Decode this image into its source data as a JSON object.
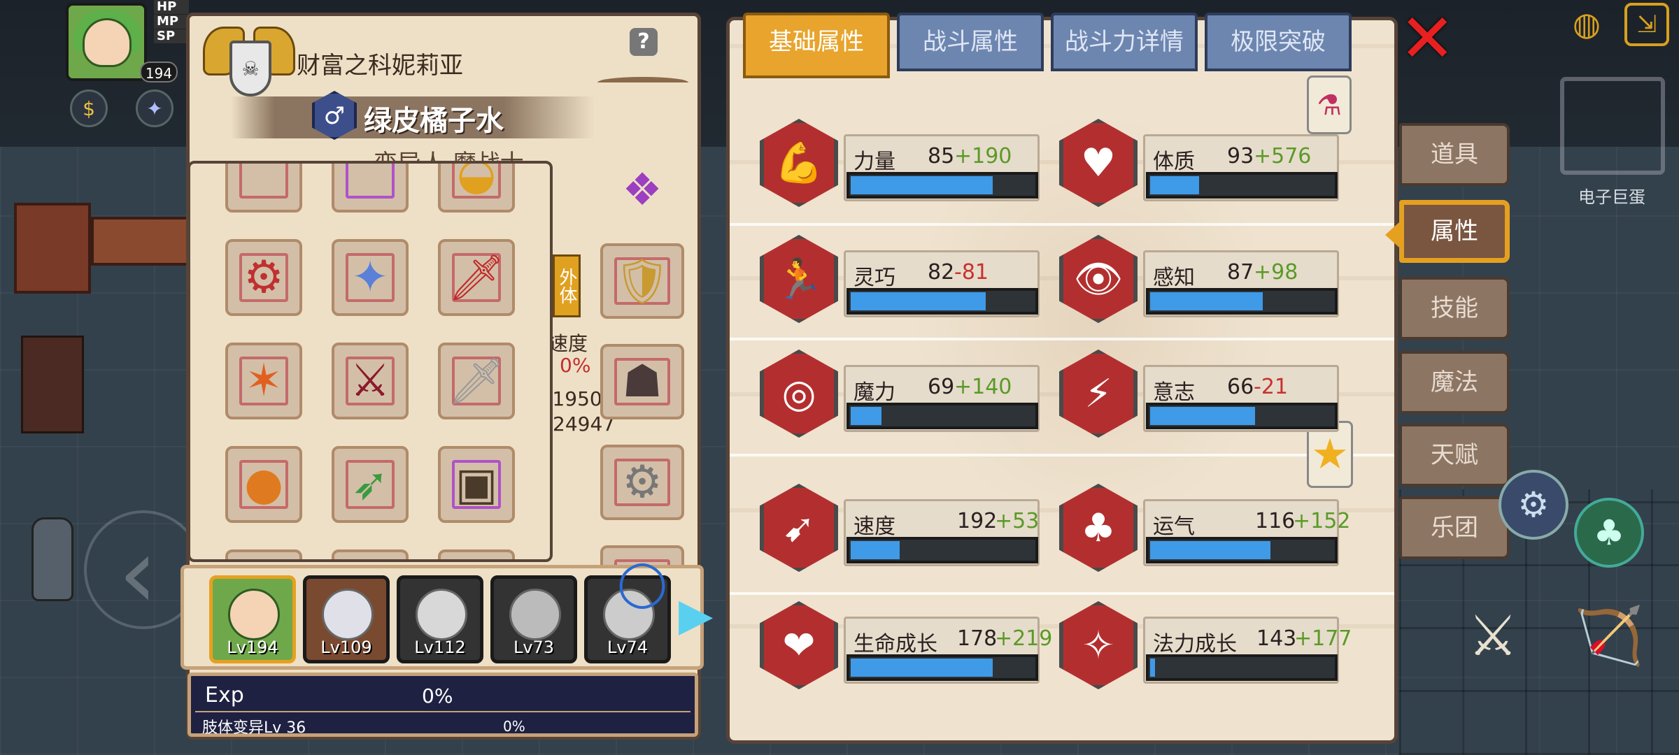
{
  "hud": {
    "level": "194",
    "bars": [
      "HP",
      "MP",
      "SP"
    ]
  },
  "character": {
    "title": "财富之科妮莉亚",
    "name": "绿皮橘子水",
    "class": "变异人 魔战士",
    "side_tag": "外体",
    "partial_text": [
      "速度",
      "0%",
      "/1950",
      "24947"
    ]
  },
  "party": [
    {
      "level": "Lv194",
      "active": true
    },
    {
      "level": "Lv109",
      "active": false
    },
    {
      "level": "Lv112",
      "active": false
    },
    {
      "level": "Lv73",
      "active": false
    },
    {
      "level": "Lv74",
      "active": false
    }
  ],
  "exp": {
    "label": "Exp",
    "value": "0%",
    "mutation_label": "肢体变异Lv 36",
    "mutation_value": "0%"
  },
  "tabs": [
    {
      "label": "基础属性",
      "active": true
    },
    {
      "label": "战斗属性",
      "active": false
    },
    {
      "label": "战斗力详情",
      "active": false
    },
    {
      "label": "极限突破",
      "active": false
    }
  ],
  "stats": [
    {
      "name": "力量",
      "base": "85",
      "bonus": "+190",
      "sign": "pos",
      "fill": 0.78,
      "icon": "muscle-icon",
      "glyph": "💪"
    },
    {
      "name": "体质",
      "base": "93",
      "bonus": "+576",
      "sign": "pos",
      "fill": 0.28,
      "icon": "body-icon",
      "glyph": "♥"
    },
    {
      "name": "灵巧",
      "base": "82",
      "bonus": "-81",
      "sign": "neg",
      "fill": 0.74,
      "icon": "runner-icon",
      "glyph": "🏃"
    },
    {
      "name": "感知",
      "base": "87",
      "bonus": "+98",
      "sign": "pos",
      "fill": 0.62,
      "icon": "eye-icon",
      "glyph": "👁"
    },
    {
      "name": "魔力",
      "base": "69",
      "bonus": "+140",
      "sign": "pos",
      "fill": 0.18,
      "icon": "swirl-icon",
      "glyph": "◎"
    },
    {
      "name": "意志",
      "base": "66",
      "bonus": "-21",
      "sign": "neg",
      "fill": 0.58,
      "icon": "mind-icon",
      "glyph": "⚡"
    },
    {
      "name": "速度",
      "base": "192",
      "bonus": "+53",
      "sign": "pos",
      "fill": 0.28,
      "icon": "speed-icon",
      "glyph": "➹"
    },
    {
      "name": "运气",
      "base": "116",
      "bonus": "+152",
      "sign": "pos",
      "fill": 0.66,
      "icon": "clover-icon",
      "glyph": "♣"
    },
    {
      "name": "生命成长",
      "base": "178",
      "bonus": "+219",
      "sign": "pos",
      "fill": 0.78,
      "icon": "heart-growth-icon",
      "glyph": "❤"
    },
    {
      "name": "法力成长",
      "base": "143",
      "bonus": "+177",
      "sign": "pos",
      "fill": 0.04,
      "icon": "mana-growth-icon",
      "glyph": "✧"
    }
  ],
  "side_nav": [
    {
      "label": "道具",
      "active": false
    },
    {
      "label": "属性",
      "active": true
    },
    {
      "label": "技能",
      "active": false
    },
    {
      "label": "魔法",
      "active": false
    },
    {
      "label": "天赋",
      "active": false
    },
    {
      "label": "乐团",
      "active": false
    }
  ],
  "world": {
    "enemy_label": "电子巨蛋"
  },
  "colors": {
    "tab_active": "#e8a42c",
    "tab_inactive": "#6d86b0",
    "stat_bar": "#3f9ae8",
    "bonus_positive": "#5a9a28",
    "bonus_negative": "#c83030",
    "hex_red": "#b32f2f"
  },
  "items": [
    {
      "icon": "cannon-gauntlet-icon",
      "glyph": "⚙",
      "purple": false
    },
    {
      "icon": "blue-wing-icon",
      "glyph": "🪶",
      "purple": false
    },
    {
      "icon": "red-fan-sword-icon",
      "glyph": "🗡",
      "purple": false
    },
    {
      "icon": "flame-claw-icon",
      "glyph": "🔥",
      "purple": false
    },
    {
      "icon": "crimson-blade-icon",
      "glyph": "⚔",
      "purple": false
    },
    {
      "icon": "silver-sword-icon",
      "glyph": "🗡",
      "purple": false
    },
    {
      "icon": "pumpkin-icon",
      "glyph": "🎃",
      "purple": false
    },
    {
      "icon": "crossbow-icon",
      "glyph": "🏹",
      "purple": false
    },
    {
      "icon": "bag-icon",
      "glyph": "👝",
      "purple": true
    }
  ],
  "equipment": [
    {
      "icon": "purple-gem-icon",
      "glyph": "❖"
    },
    {
      "icon": "golden-armor-icon",
      "glyph": "🛡"
    },
    {
      "icon": "dark-mask-icon",
      "glyph": "☗"
    },
    {
      "icon": "mech-boots-icon",
      "glyph": "⚙"
    },
    {
      "icon": "blue-ring-icon",
      "glyph": "◯"
    }
  ]
}
